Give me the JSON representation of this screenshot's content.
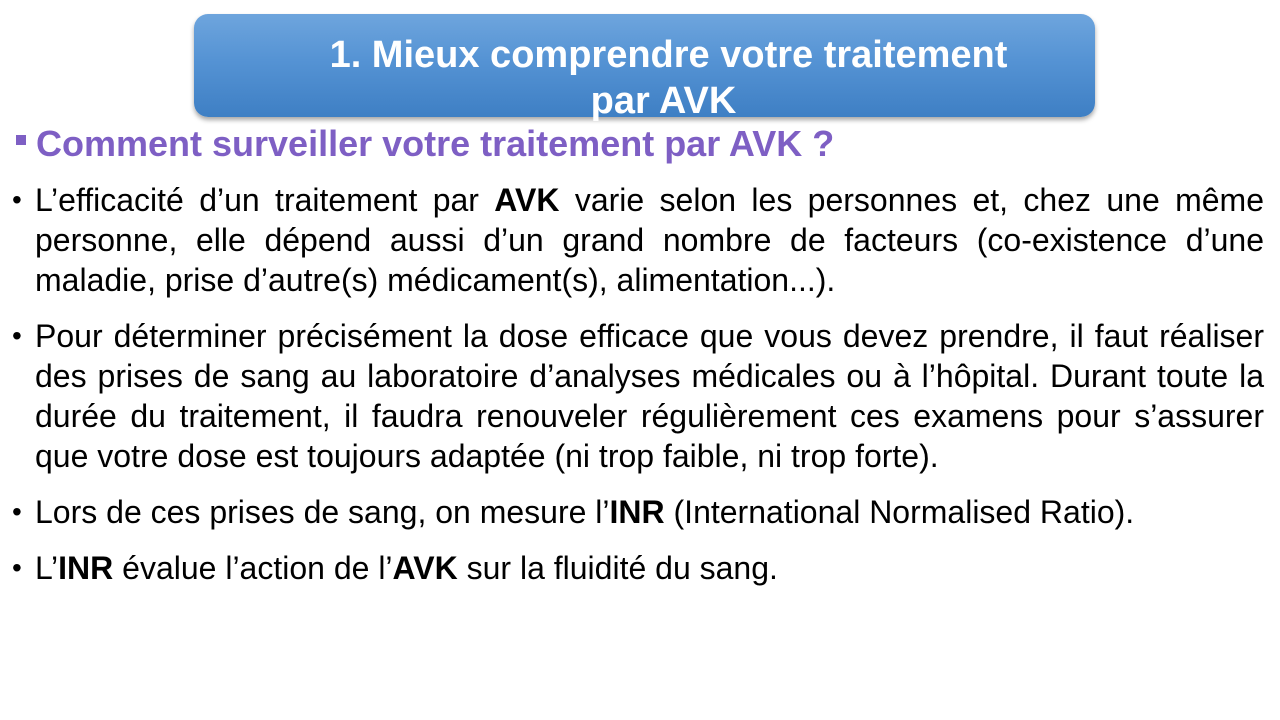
{
  "title": {
    "line1": "1. Mieux comprendre votre traitement",
    "line2": "par AVK"
  },
  "subtitle": "Comment surveiller votre traitement par AVK ?",
  "bullets": {
    "b1": {
      "part1": "L’efficacité d’un traitement par ",
      "bold1": "AVK",
      "part2": " varie selon les personnes et, chez une même personne, elle dépend aussi d’un grand nombre de facteurs (co-existence d’une maladie, prise d’autre(s) médicament(s), alimentation...)."
    },
    "b2": {
      "text": "Pour déterminer précisément la dose efficace que vous devez prendre, il faut réaliser des prises de sang au laboratoire d’analyses médicales ou à l’hôpital. Durant toute la durée du traitement, il faudra renouveler régulièrement ces examens pour s’assurer que votre dose est toujours adaptée (ni trop faible, ni trop forte)."
    },
    "b3": {
      "part1": "Lors de ces prises de sang, on mesure l’",
      "bold1": "INR",
      "part2": " (International Normalised Ratio)."
    },
    "b4": {
      "part1": "L’",
      "bold1": "INR",
      "part2": " évalue l’action de l’",
      "bold2": "AVK",
      "part3": " sur la fluidité du sang."
    }
  }
}
